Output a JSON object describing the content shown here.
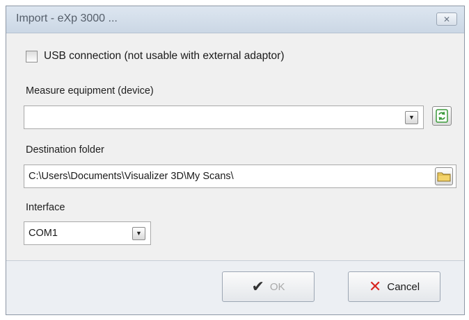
{
  "window": {
    "title": "Import - eXp 3000 ...",
    "close_icon": "close-icon"
  },
  "usb": {
    "label": "USB connection (not usable with external adaptor)",
    "checked": false
  },
  "device": {
    "label": "Measure equipment (device)",
    "value": "",
    "dropdown_icon": "chevron-down-icon",
    "refresh_icon": "refresh-icon"
  },
  "destination": {
    "label": "Destination folder",
    "value": "C:\\Users\\Documents\\Visualizer 3D\\My Scans\\",
    "folder_icon": "folder-icon"
  },
  "interface": {
    "label": "Interface",
    "value": "COM1",
    "dropdown_icon": "chevron-down-icon"
  },
  "buttons": {
    "ok": {
      "label": "OK",
      "icon": "checkmark-icon",
      "enabled": false
    },
    "cancel": {
      "label": "Cancel",
      "icon": "x-icon"
    }
  },
  "colors": {
    "ok_disabled_text": "#a9a9a9",
    "cancel_x": "#d8251f",
    "refresh_green": "#3a9a3a",
    "folder_yellow": "#f3d36b"
  }
}
